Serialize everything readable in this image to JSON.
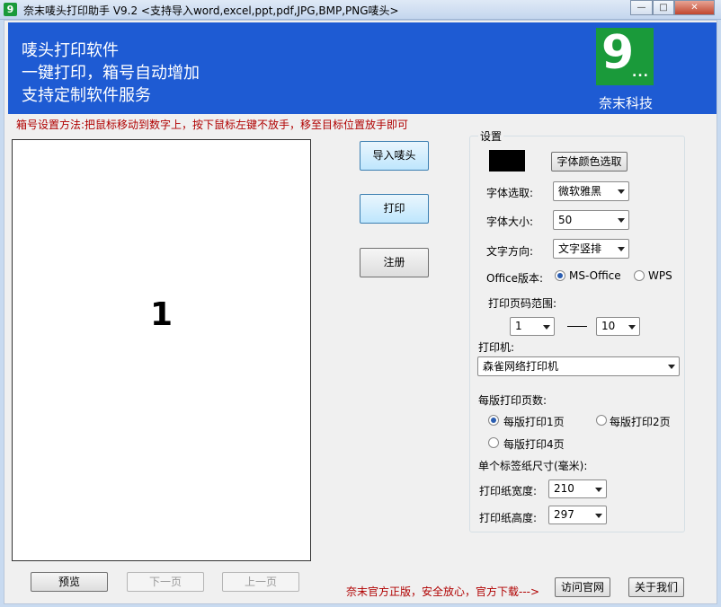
{
  "window": {
    "title": "奈末唛头打印助手  V9.2   <支持导入word,excel,ppt,pdf,JPG,BMP,PNG唛头>",
    "minimize_glyph": "—",
    "maximize_glyph": "□",
    "close_glyph": "✕"
  },
  "banner": {
    "line1": "唛头打印软件",
    "line2": "一键打印，箱号自动增加",
    "line3": "支持定制软件服务",
    "logo_glyph": "9",
    "logo_dots": "...",
    "company": "奈末科技",
    "color": "#1e5bd3",
    "logo_color": "#1a9a3a"
  },
  "hint": "箱号设置方法:把鼠标移动到数字上，按下鼠标左键不放手，移至目标位置放手即可",
  "preview": {
    "box_number": "1"
  },
  "actions": {
    "import": "导入唛头",
    "print": "打印",
    "register": "注册"
  },
  "navigation": {
    "preview": "预览",
    "next": "下一页",
    "prev": "上一页"
  },
  "settings": {
    "title": "设置",
    "font_color_button": "字体颜色选取",
    "font_color_swatch": "#000000",
    "font_label": "字体选取:",
    "font_value": "微软雅黑",
    "size_label": "字体大小:",
    "size_value": "50",
    "direction_label": "文字方向:",
    "direction_value": "文字竖排",
    "office_label": "Office版本:",
    "office_options": [
      "MS-Office",
      "WPS"
    ],
    "office_selected": "MS-Office",
    "page_range_label": "打印页码范围:",
    "page_from": "1",
    "page_to": "10",
    "printer_label": "打印机:",
    "printer_value": "森雀网络打印机",
    "per_sheet_label": "每版打印页数:",
    "per_sheet_options": [
      "每版打印1页",
      "每版打印2页",
      "每版打印4页"
    ],
    "per_sheet_selected": "每版打印1页",
    "label_size_label": "单个标签纸尺寸(毫米):",
    "width_label": "打印纸宽度:",
    "width_value": "210",
    "height_label": "打印纸高度:",
    "height_value": "297"
  },
  "footer": {
    "notice": "奈末官方正版，安全放心，官方下载--->",
    "visit_site": "访问官网",
    "about": "关于我们"
  }
}
